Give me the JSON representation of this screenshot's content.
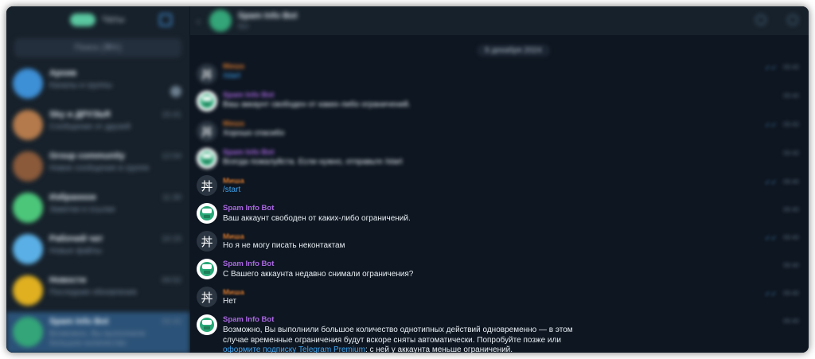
{
  "sidebar": {
    "title": "Чаты",
    "search_placeholder": "Поиск (⌘K)",
    "chats": [
      {
        "name": "Архив",
        "time": "",
        "preview": "Каналы и группы",
        "color": "#3d8fd6"
      },
      {
        "name": "Sky и ДРУЗЬЯ",
        "time": "15:41",
        "preview": "Сообщение от друзей",
        "color": "#b57a4b"
      },
      {
        "name": "Group community",
        "time": "12:04",
        "preview": "Новое сообщение в группе",
        "color": "#8b5a3a"
      },
      {
        "name": "Избранное",
        "time": "11:30",
        "preview": "Заметки и ссылки",
        "color": "#4cc77a"
      },
      {
        "name": "Рабочий чат",
        "time": "10:15",
        "preview": "Новые файлы",
        "color": "#5ab0e6"
      },
      {
        "name": "Новости",
        "time": "09:52",
        "preview": "Последние обновления",
        "color": "#e0b020"
      },
      {
        "name": "Spam Info Bot",
        "time": "09:40",
        "preview": "Возможно, Вы выполнили большое количество",
        "color": "#33a578"
      }
    ]
  },
  "header": {
    "chat_name": "Spam Info Bot",
    "subtitle": "бот"
  },
  "date_label": "9 декабря 2024",
  "messages": [
    {
      "type": "user",
      "sender": "Миша",
      "text": "/start",
      "is_command": true
    },
    {
      "type": "bot",
      "sender": "Spam Info Bot",
      "text": "Ваш аккаунт свободен от каких-либо ограничений."
    },
    {
      "type": "user",
      "sender": "Миша",
      "text": "Хорошо спасибо"
    },
    {
      "type": "bot",
      "sender": "Spam Info Bot",
      "text": "Всегда пожалуйста. Если нужно, отправьте /start"
    },
    {
      "type": "user",
      "sender": "Миша",
      "text": "/start",
      "is_command": true
    },
    {
      "type": "bot",
      "sender": "Spam Info Bot",
      "text": "Ваш аккаунт свободен от каких-либо ограничений."
    },
    {
      "type": "user",
      "sender": "Миша",
      "text": "Но я не могу писать неконтактам"
    },
    {
      "type": "bot",
      "sender": "Spam Info Bot",
      "text": "С Вашего аккаунта недавно снимали ограничения?"
    },
    {
      "type": "user",
      "sender": "Миша",
      "text": "Нет"
    },
    {
      "type": "bot",
      "sender": "Spam Info Bot",
      "text_line1": "Возможно, Вы выполнили большое количество однотипных действий одновременно — в этом",
      "text_line2": "случае временные ограничения будут вскоре сняты автоматически. Попробуйте позже или",
      "link_text": "оформите подписку Telegram Premium",
      "text_tail": ": с ней у аккаунта меньше ограничений."
    }
  ],
  "message_time": "09:40",
  "user_avatar_glyph": "丼"
}
